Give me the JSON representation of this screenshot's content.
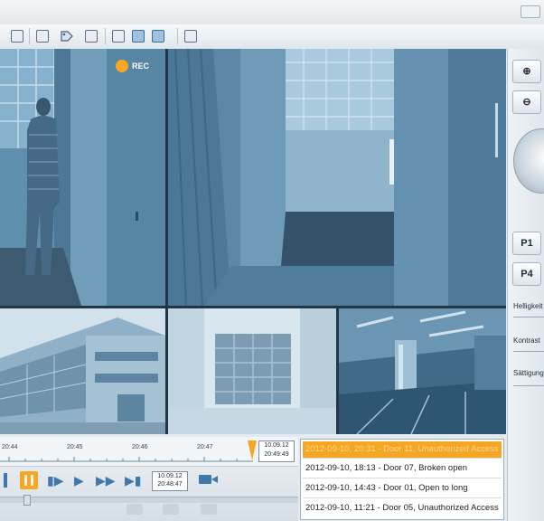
{
  "recording": {
    "label": "REC",
    "indicator_color": "#f5a623"
  },
  "toolbar": {
    "icons": [
      "grid-icon",
      "zoom-window-icon",
      "tag-icon",
      "export-icon",
      "layout-1-icon",
      "layout-2-icon",
      "layout-3-icon",
      "layout-4-icon"
    ]
  },
  "timeline": {
    "ticks": [
      "20:44",
      "20:45",
      "20:46",
      "20:47"
    ],
    "marker_date": "10.09.12",
    "marker_time": "20:49:49",
    "playback_date": "10.09.12",
    "playback_time": "20:48:47"
  },
  "events": [
    {
      "text": "2012-09-10, 20:31 - Door 11, Unauthorized Access",
      "selected": true
    },
    {
      "text": "2012-09-10, 18:13 - Door 07, Broken open",
      "selected": false
    },
    {
      "text": "2012-09-10, 14:43 - Door 01, Open to long",
      "selected": false
    },
    {
      "text": "2012-09-10, 11:21 - Door 05, Unauthorized Access",
      "selected": false
    }
  ],
  "ptz": {
    "presets": [
      "P1",
      "P4"
    ],
    "sliders": [
      "Helligkeit",
      "Kontrast",
      "Sättigung"
    ]
  },
  "colors": {
    "accent": "#f5a623",
    "video_tint": "#5b8aa8",
    "toolbar_icon": "#3e79ad"
  }
}
